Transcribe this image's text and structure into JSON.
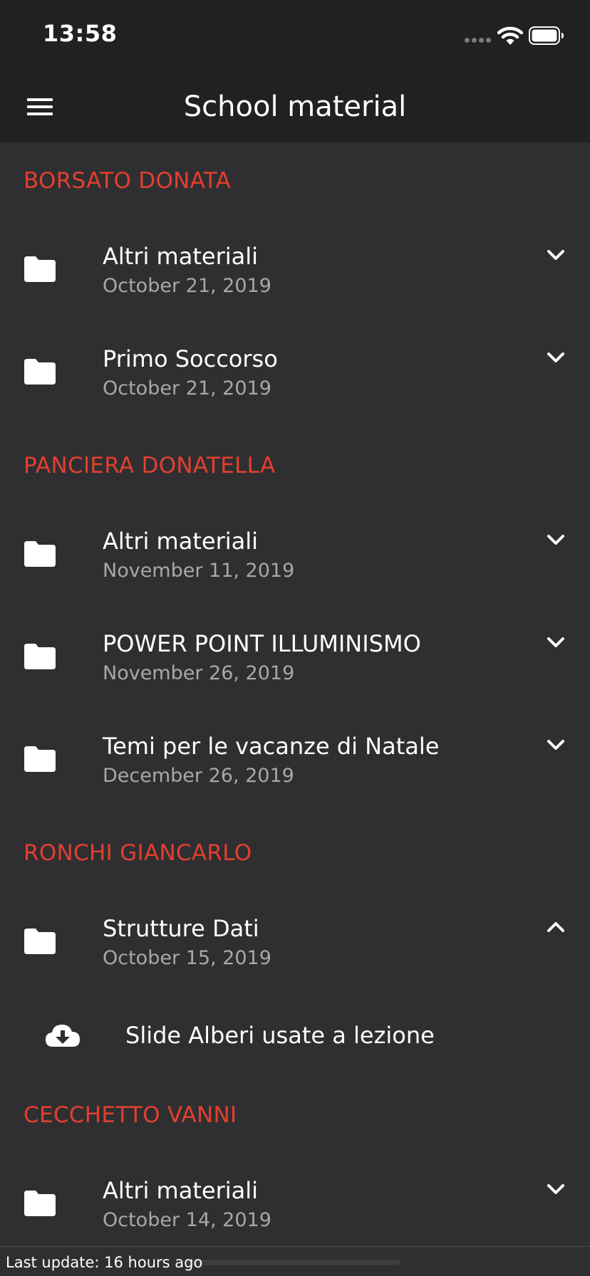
{
  "status_bar": {
    "time": "13:58"
  },
  "header": {
    "title": "School material",
    "menu_icon": "hamburger-menu-icon"
  },
  "colors": {
    "accent": "#E23F30",
    "background": "#2F2F31",
    "bar_background": "#212122",
    "secondary_text": "#A8A8AA"
  },
  "sections": [
    {
      "teacher": "BORSATO DONATA",
      "folders": [
        {
          "title": "Altri materiali",
          "date": "October 21, 2019",
          "expanded": false
        },
        {
          "title": "Primo Soccorso",
          "date": "October 21, 2019",
          "expanded": false
        }
      ]
    },
    {
      "teacher": "PANCIERA DONATELLA",
      "folders": [
        {
          "title": "Altri materiali",
          "date": "November 11, 2019",
          "expanded": false
        },
        {
          "title": "POWER POINT ILLUMINISMO",
          "date": "November 26, 2019",
          "expanded": false
        },
        {
          "title": "Temi per le vacanze di Natale",
          "date": "December 26, 2019",
          "expanded": false
        }
      ]
    },
    {
      "teacher": "RONCHI GIANCARLO",
      "folders": [
        {
          "title": "Strutture Dati",
          "date": "October 15, 2019",
          "expanded": true,
          "files": [
            {
              "name": "Slide Alberi usate a lezione",
              "icon": "cloud-download-icon"
            }
          ]
        }
      ]
    },
    {
      "teacher": "CECCHETTO VANNI",
      "folders": [
        {
          "title": "Altri materiali",
          "date": "October 14, 2019",
          "expanded": false
        }
      ]
    }
  ],
  "footer": {
    "text": "Last update: 16 hours ago"
  }
}
